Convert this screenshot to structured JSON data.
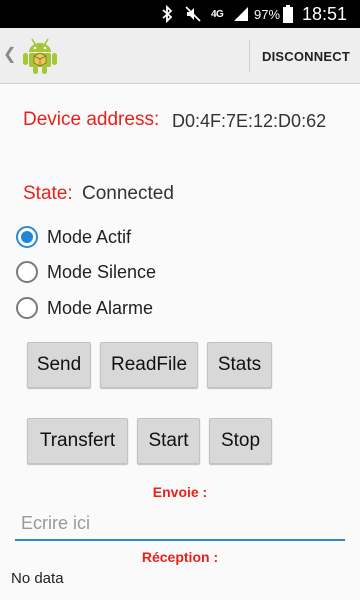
{
  "status_bar": {
    "network": "4G",
    "battery": "97%",
    "time": "18:51",
    "icons": [
      "bluetooth-icon",
      "mute-icon",
      "signal-icon",
      "battery-icon"
    ]
  },
  "action_bar": {
    "back_icon": "chevron-left-icon",
    "logo_icon": "android-logo-icon",
    "disconnect_label": "DISCONNECT"
  },
  "device": {
    "label": "Device address:",
    "value": "D0:4F:7E:12:D0:62"
  },
  "state": {
    "label": "State:",
    "value": "Connected"
  },
  "modes": [
    {
      "label": "Mode Actif",
      "checked": true
    },
    {
      "label": "Mode Silence",
      "checked": false
    },
    {
      "label": "Mode Alarme",
      "checked": false
    }
  ],
  "buttons": {
    "send": "Send",
    "readfile": "ReadFile",
    "stats": "Stats",
    "transfert": "Transfert",
    "start": "Start",
    "stop": "Stop"
  },
  "send_section": {
    "label": "Envoie :",
    "placeholder": "Ecrire ici",
    "value": ""
  },
  "reception": {
    "label": "Réception :",
    "value": "No data"
  },
  "colors": {
    "accent_red": "#e8211b",
    "accent_blue": "#2b8ad4",
    "android_green": "#a4c639"
  }
}
